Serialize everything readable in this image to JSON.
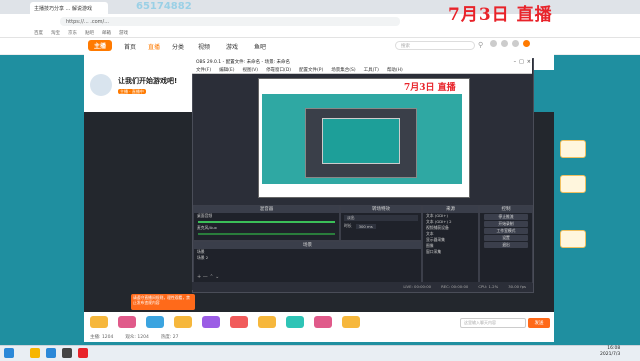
{
  "browser": {
    "tab_title": "主播技巧分享 ... 解说游戏",
    "url": "https://... .com/...",
    "bookmarks": [
      "百度",
      "淘宝",
      "京东",
      "贴吧",
      "邮箱",
      "游戏"
    ]
  },
  "overlay": {
    "id_text": "65174882",
    "headline": "7月3日 直播"
  },
  "site_nav": {
    "logo": "主播",
    "items": [
      "首页",
      "直播",
      "分类",
      "视频",
      "游戏",
      "鱼吧"
    ],
    "search_placeholder": "搜索"
  },
  "streamer": {
    "title": "让我们开始游戏吧!",
    "sub": "主播 · 直播中"
  },
  "obs": {
    "title": "OBS 29.0.1 - 配置文件: 未命名 - 场景: 未命名",
    "menu": [
      "文件(F)",
      "编辑(E)",
      "视图(V)",
      "停靠窗口(D)",
      "配置文件(P)",
      "场景集合(S)",
      "工具(T)",
      "帮助(H)"
    ],
    "preview_title": "7月3日 直播",
    "panels": {
      "mixer": "混音器",
      "transitions": "转场特效",
      "scenes": "场景",
      "sources": "来源",
      "controls": "控制"
    },
    "mixer_tracks": [
      "桌面音频",
      "麦克风/Aux"
    ],
    "transition": {
      "name": "淡出",
      "duration_label": "时长",
      "duration_value": "300 ms"
    },
    "scenes": [
      "场景",
      "场景 2"
    ],
    "sources": [
      "文本 (GDI+)",
      "文本 (GDI+) 2",
      "视频捕获设备",
      "文本",
      "显示器采集",
      "图像",
      "窗口采集"
    ],
    "controls": [
      "停止推流",
      "开始录制",
      "工作室模式",
      "设置",
      "退出"
    ],
    "status": [
      "LIVE: 00:00:00",
      "REC: 00:00:00",
      "CPU: 1.2%",
      "30.00 fps"
    ]
  },
  "chat": {
    "notice": "请遵守直播间规则，理性观看，禁止发布违规内容",
    "input_placeholder": "这里输入聊天内容",
    "send": "发送"
  },
  "stats": [
    "主播: 1204",
    "观众: 1204",
    "热度: 27"
  ],
  "taskbar": {
    "time": "16:08",
    "date": "2021/7/3"
  },
  "colors": {
    "accent": "#ff7a00",
    "headline": "#e8232a",
    "obs_bg": "#2b2e38",
    "teal": "#1f8fa0"
  }
}
